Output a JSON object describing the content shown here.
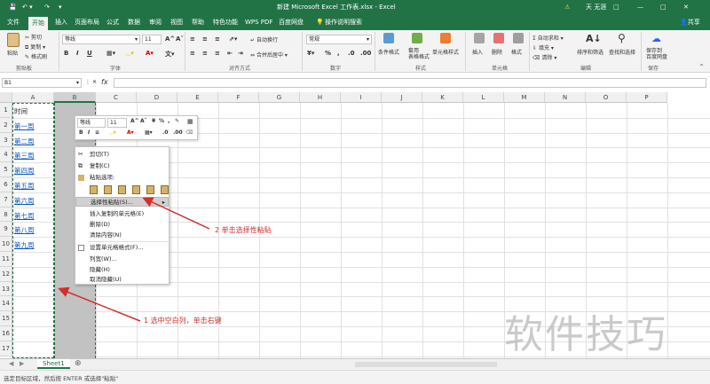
{
  "titlebar": {
    "file_title": "新建 Microsoft Excel 工作表.xlsx - Excel",
    "user": "天 无涯",
    "warning_icon": "warning-icon",
    "search_icon": "lightbulb-icon",
    "controls": [
      "minimize-icon",
      "restore-icon",
      "close-icon"
    ]
  },
  "tabs": [
    "文件",
    "开始",
    "插入",
    "页面布局",
    "公式",
    "数据",
    "审阅",
    "视图",
    "帮助",
    "特色功能",
    "WPS PDF",
    "百度网盘"
  ],
  "tell_me": "操作说明搜索",
  "share": "共享",
  "ribbon": {
    "paste": "粘贴",
    "cut": "剪切",
    "copy": "复制",
    "format_painter": "格式刷",
    "clipboard_group": "剪贴板",
    "font_group": "字体",
    "align_group": "对齐方式",
    "number_group": "数字",
    "styles_group": "样式",
    "cells_group": "单元格",
    "edit_group": "编辑",
    "save_group": "保存",
    "font_name": "等线",
    "font_size": "11",
    "bold": "B",
    "italic": "I",
    "underline": "U",
    "wrap_text": "自动换行",
    "merge_center": "合并后居中",
    "number_format": "常规",
    "cond_format": "条件格式",
    "table_format": "套用\n表格格式",
    "cell_style": "单元格样式",
    "insert": "插入",
    "delete": "删除",
    "format": "格式",
    "autosum": "自动求和",
    "fill": "填充",
    "clear": "清除",
    "sort_filter": "排序和筛选",
    "find_select": "查找和选择",
    "save_baidu": "保存到\n百度网盘",
    "percent": "%",
    "comma": ","
  },
  "namebox": "B1",
  "fx": "fx",
  "columns": [
    "A",
    "B",
    "C",
    "D",
    "E",
    "F",
    "G",
    "H",
    "I",
    "J",
    "K",
    "L",
    "M",
    "N",
    "O",
    "P"
  ],
  "rows": [
    "1",
    "2",
    "3",
    "4",
    "5",
    "6",
    "7",
    "8",
    "9",
    "10",
    "11",
    "12",
    "13",
    "14",
    "15",
    "16",
    "17"
  ],
  "column_a": [
    "时间",
    "第一周",
    "第二周",
    "第三周",
    "第四周",
    "第五周",
    "第六周",
    "第七周",
    "第八周",
    "第九周"
  ],
  "mini_toolbar": {
    "font": "等线",
    "size": "11",
    "bold": "B",
    "italic": "I",
    "align": "≡"
  },
  "context_menu": {
    "cut": "剪切(T)",
    "copy": "复制(C)",
    "paste_options": "粘贴选项:",
    "paste_special": "选择性粘贴(S)...",
    "insert_copied": "插入复制的单元格(E)",
    "delete": "删除(D)",
    "clear_contents": "清除内容(N)",
    "format_cells": "设置单元格格式(F)...",
    "column_width": "列宽(W)...",
    "hide": "隐藏(H)",
    "unhide": "取消隐藏(U)"
  },
  "annotations": {
    "step1": "1 选中空白列，单击右键",
    "step2": "2 单击选择性粘贴"
  },
  "sheet_tab": "Sheet1",
  "status": "选定目标区域，然后按 ENTER 或选择\"粘贴\"",
  "watermark": "软件技巧",
  "colors": {
    "excel_green": "#217346",
    "annotation_red": "#d32f2f",
    "link_blue": "#0b55c4",
    "selection_gray": "#c2c2c2"
  }
}
